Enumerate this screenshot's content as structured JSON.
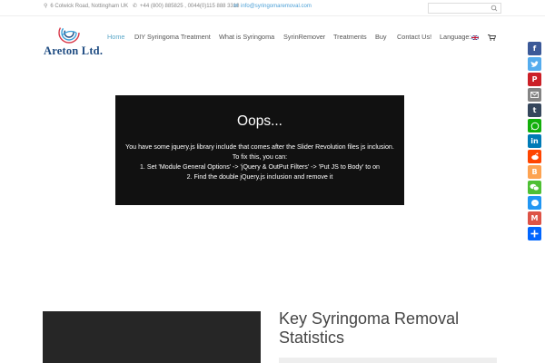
{
  "topbar": {
    "address": "6 Colwick Road, Nottingham UK",
    "phone": "+44 (800) 885825 , 0044(0)115 888 3318",
    "email": "info@syringomaremoval.com",
    "search_placeholder": ""
  },
  "logo": {
    "text": "Areton Ltd."
  },
  "nav": {
    "items": [
      {
        "label": "Home",
        "active": true
      },
      {
        "label": "DIY Syringoma Treatment",
        "active": false
      },
      {
        "label": "What is Syringoma",
        "active": false
      },
      {
        "label": "SyrinRemover",
        "active": false
      },
      {
        "label": "Treatments",
        "active": false
      },
      {
        "label": "Buy",
        "active": false
      },
      {
        "label": "Contact Us!",
        "active": false
      },
      {
        "label": "Language:",
        "active": false
      }
    ],
    "language_flag": "uk-flag-icon",
    "cart_icon": "cart-icon"
  },
  "error": {
    "title": "Oops...",
    "lines": [
      "You have some jquery.js library include that comes after the Slider Revolution files js inclusion.",
      "To fix this, you can:",
      "1. Set 'Module General Options' -> 'jQuery & OutPut Filters' -> 'Put JS to Body' to on",
      "2. Find the double jQuery.js inclusion and remove it"
    ]
  },
  "stats": {
    "title": "Key Syringoma Removal Statistics"
  },
  "share_buttons": [
    {
      "name": "facebook",
      "color": "#3b5998"
    },
    {
      "name": "twitter",
      "color": "#55acee"
    },
    {
      "name": "pinterest",
      "color": "#cb2027"
    },
    {
      "name": "email",
      "color": "#848484"
    },
    {
      "name": "tumblr",
      "color": "#35465c"
    },
    {
      "name": "whatsapp",
      "color": "#12af0a"
    },
    {
      "name": "linkedin",
      "color": "#007bb6"
    },
    {
      "name": "reddit",
      "color": "#ff4500"
    },
    {
      "name": "blogger",
      "color": "#fda352"
    },
    {
      "name": "wechat",
      "color": "#4ec034"
    },
    {
      "name": "messenger",
      "color": "#2196f3"
    },
    {
      "name": "gmail",
      "color": "#dd5347"
    },
    {
      "name": "share",
      "color": "#0166ff"
    }
  ],
  "colors": {
    "accent": "#5aa7c8",
    "nav_text": "#555555",
    "logo_text": "#1f4c82",
    "error_bg": "#111111"
  }
}
